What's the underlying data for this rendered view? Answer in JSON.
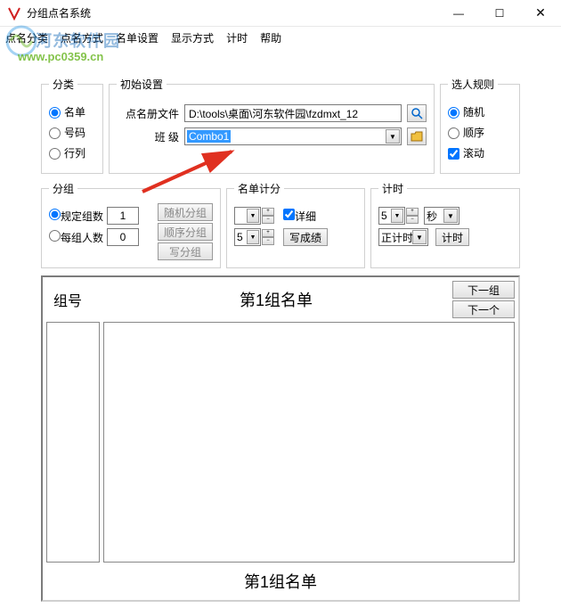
{
  "window": {
    "title": "分组点名系统"
  },
  "menu": {
    "m1": "点名分类",
    "m2": "点名方式",
    "m3": "名单设置",
    "m4": "显示方式",
    "m5": "计时",
    "m6": "帮助"
  },
  "watermark": {
    "text": "河东软件园",
    "url": "www.pc0359.cn"
  },
  "category": {
    "legend": "分类",
    "opt1": "名单",
    "opt2": "号码",
    "opt3": "行列"
  },
  "init": {
    "legend": "初始设置",
    "fileLabel": "点名册文件",
    "filePath": "D:\\tools\\桌面\\河东软件园\\fzdmxt_12",
    "classLabel": "班 级",
    "classValue": "Combo1"
  },
  "rule": {
    "legend": "选人规则",
    "opt1": "随机",
    "opt2": "顺序",
    "chk": "滚动"
  },
  "group": {
    "legend": "分组",
    "opt1": "规定组数",
    "val1": "1",
    "btn1": "随机分组",
    "opt2": "每组人数",
    "val2": "0",
    "btn2": "顺序分组",
    "btn3": "写分组"
  },
  "score": {
    "legend": "名单计分",
    "chk": "详细",
    "spin": "5",
    "btn": "写成绩"
  },
  "timer": {
    "legend": "计时",
    "val": "5",
    "unit": "秒",
    "mode": "正计时",
    "btn": "计时"
  },
  "list": {
    "groupNo": "组号",
    "title": "第1组名单",
    "nextGroup": "下一组",
    "nextOne": "下一个",
    "foot": "第1组名单"
  }
}
